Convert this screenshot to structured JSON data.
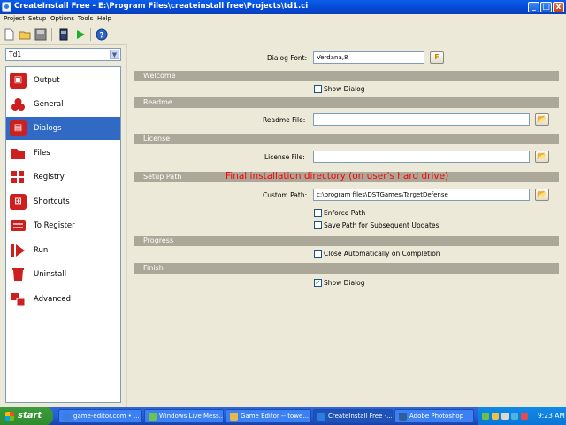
{
  "window": {
    "title": "CreateInstall Free - E:\\Program Files\\createinstall free\\Projects\\td1.ci",
    "controls": {
      "minimize": "_",
      "maximize": "□",
      "close": "x"
    }
  },
  "menu": [
    "Project",
    "Setup",
    "Options",
    "Tools",
    "Help"
  ],
  "toolbar": {
    "icons": [
      "new-icon",
      "open-icon",
      "save-icon",
      "build-icon",
      "run-icon",
      "help-icon"
    ]
  },
  "project_combo": {
    "value": "Td1"
  },
  "nav": {
    "selected": "Dialogs",
    "items": [
      {
        "label": "Output",
        "icon": "output-icon",
        "color": "#cc1f1f"
      },
      {
        "label": "General",
        "icon": "general-icon",
        "color": "#cc1f1f"
      },
      {
        "label": "Dialogs",
        "icon": "dialogs-icon",
        "color": "#cc1f1f"
      },
      {
        "label": "Files",
        "icon": "files-icon",
        "color": "#cc1f1f"
      },
      {
        "label": "Registry",
        "icon": "registry-icon",
        "color": "#cc1f1f"
      },
      {
        "label": "Shortcuts",
        "icon": "shortcuts-icon",
        "color": "#cc1f1f"
      },
      {
        "label": "To Register",
        "icon": "to-register-icon",
        "color": "#cc1f1f"
      },
      {
        "label": "Run",
        "icon": "run-icon",
        "color": "#cc1f1f"
      },
      {
        "label": "Uninstall",
        "icon": "uninstall-icon",
        "color": "#cc1f1f"
      },
      {
        "label": "Advanced",
        "icon": "advanced-icon",
        "color": "#cc1f1f"
      }
    ]
  },
  "dialog_font": {
    "label": "Dialog Font:",
    "value": "Verdana,8"
  },
  "sections": {
    "welcome": {
      "title": "Welcome",
      "show_dialog": {
        "label": "Show Dialog",
        "checked": false
      }
    },
    "readme": {
      "title": "Readme",
      "file_label": "Readme File:",
      "file_value": ""
    },
    "license": {
      "title": "License",
      "file_label": "License File:",
      "file_value": ""
    },
    "setup_path": {
      "title": "Setup Path",
      "annotation": "Final installation directory (on user's hard drive)",
      "custom_path_label": "Custom Path:",
      "custom_path_value": "c:\\program files\\DSTGames\\TargetDefense",
      "enforce_path": {
        "label": "Enforce Path",
        "checked": false
      },
      "save_path": {
        "label": "Save Path for Subsequent Updates",
        "checked": false
      }
    },
    "progress": {
      "title": "Progress",
      "close_auto": {
        "label": "Close Automatically on Completion",
        "checked": false
      }
    },
    "finish": {
      "title": "Finish",
      "show_dialog": {
        "label": "Show Dialog",
        "checked": true
      }
    }
  },
  "taskbar": {
    "start_label": "start",
    "tasks": [
      {
        "label": "game-editor.com • ...",
        "active": false
      },
      {
        "label": "Windows Live Mess...",
        "active": false
      },
      {
        "label": "Game Editor -- towe...",
        "active": false
      },
      {
        "label": "CreateInstall Free -...",
        "active": true
      },
      {
        "label": "Adobe Photoshop",
        "active": false
      }
    ],
    "clock": "9:23 AM"
  }
}
